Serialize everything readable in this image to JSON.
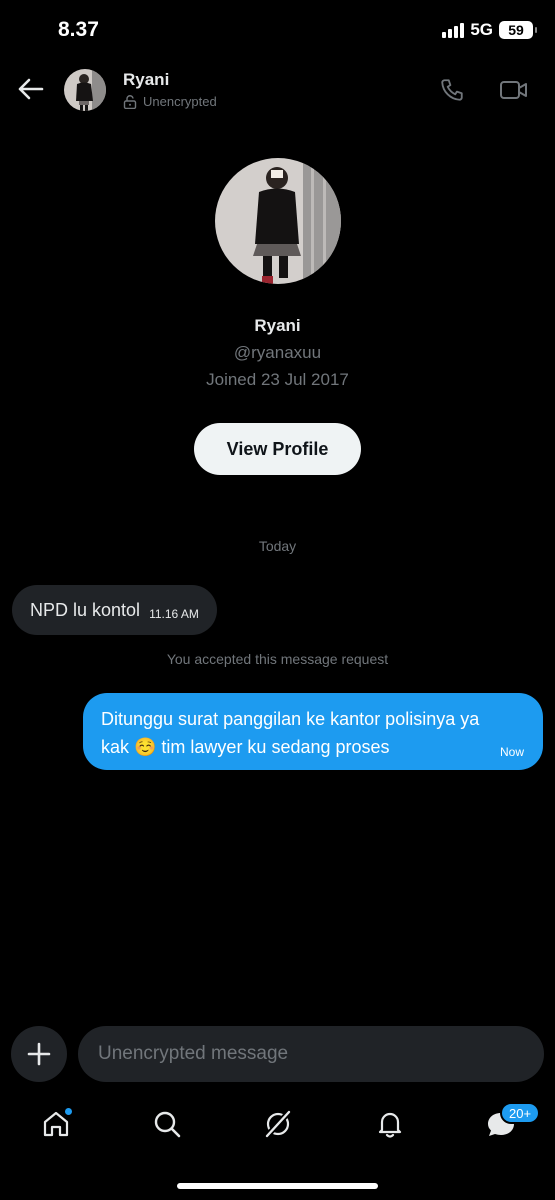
{
  "status_bar": {
    "time": "8.37",
    "network": "5G",
    "battery": "59"
  },
  "header": {
    "name": "Ryani",
    "encryption_status": "Unencrypted"
  },
  "profile": {
    "name": "Ryani",
    "handle": "@ryanaxuu",
    "joined": "Joined 23 Jul 2017",
    "view_profile_label": "View Profile"
  },
  "conversation": {
    "date_separator": "Today",
    "incoming": {
      "text": "NPD lu kontol",
      "time": "11.16 AM"
    },
    "system_note": "You accepted this message request",
    "outgoing": {
      "text": "Ditunggu surat panggilan ke kantor polisinya ya kak ☺️ tim lawyer ku sedang proses",
      "time": "Now"
    }
  },
  "composer": {
    "placeholder": "Unencrypted message"
  },
  "tabbar": {
    "items": [
      "home-icon",
      "search-icon",
      "grok-icon",
      "notifications-icon",
      "messages-icon"
    ],
    "messages_badge": "20+"
  },
  "colors": {
    "accent": "#1d9bf0",
    "background": "#000000",
    "bubble_incoming": "#202327",
    "muted_text": "#71767b"
  }
}
